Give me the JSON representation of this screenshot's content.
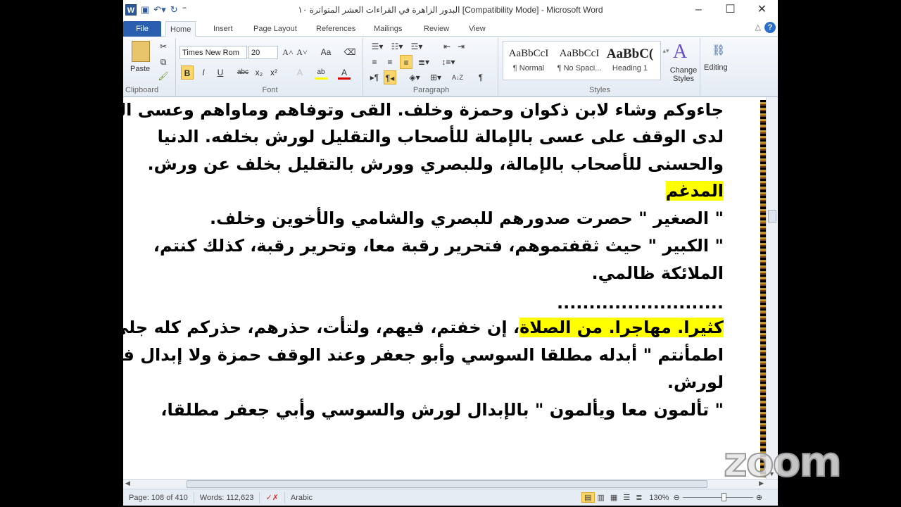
{
  "window": {
    "title": "البدور الزاهرة في القراءات العشر المتواترة ١٠ [Compatibility Mode]  -  Microsoft Word",
    "app_icon": "W"
  },
  "tabs": [
    "File",
    "Home",
    "Insert",
    "Page Layout",
    "References",
    "Mailings",
    "Review",
    "View"
  ],
  "ribbon": {
    "clipboard": {
      "paste": "Paste",
      "label": "Clipboard"
    },
    "font": {
      "name": "Times New Rom",
      "size": "20",
      "label": "Font",
      "bold": "B",
      "italic": "I",
      "underline": "U",
      "strike": "abc",
      "sub": "x₂",
      "sup": "x²",
      "grow": "A˄",
      "shrink": "A˅",
      "case": "Aa",
      "color": "A",
      "highlight": "ab"
    },
    "paragraph": {
      "label": "Paragraph",
      "pilcrow": "¶",
      "sort": "A↓Z"
    },
    "styles": {
      "label": "Styles",
      "items": [
        {
          "sample": "AaBbCcI",
          "name": "¶ Normal"
        },
        {
          "sample": "AaBbCcI",
          "name": "¶ No Spaci..."
        },
        {
          "sample": "AaBbC(",
          "name": "Heading 1"
        }
      ],
      "change": "Change Styles"
    },
    "editing": {
      "label": "Editing"
    }
  },
  "document": {
    "lines": [
      "جاءوكم وشاء لابن ذكوان وحمزة وخلف. القى وتوفاهم وماواهم وعسى الله",
      "لدى الوقف على عسى بالإمالة للأصحاب والتقليل لورش بخلفه. الدنيا",
      "والحسنى للأصحاب بالإمالة، وللبصري وورش بالتقليل بخلف عن ورش.",
      "المدغم",
      "\" الصغير \" حصرت صدورهم للبصري والشامي والأخوين وخلف.",
      "\" الكبير \" حيث ثقفتموهم، فتحرير رقبة معا، وتحرير رقبة، كذلك كنتم،",
      "الملائكة ظالمي.",
      "..........................",
      "اطمأنتم \" أبدله مطلقا السوسي وأبو جعفر وعند الوقف حمزة ولا إبدال فيه",
      "لورش.",
      "\" تألمون معا ويألمون \" بالإبدال لورش والسوسي وأبي جعفر مطلقا،"
    ],
    "highlighted_line": {
      "highlight": "كثيرا. مهاجرا. من الصلاة",
      "rest": "، إن خفتم، فيهم، ولتأت، حذرهم، حذركم كله جلي،"
    }
  },
  "status": {
    "page": "Page: 108 of 410",
    "words": "Words: 112,623",
    "language": "Arabic",
    "zoom": "130%"
  },
  "watermark": "zoom",
  "colors": {
    "highlight": "#ffff00",
    "file_tab": "#2a5fb0"
  }
}
